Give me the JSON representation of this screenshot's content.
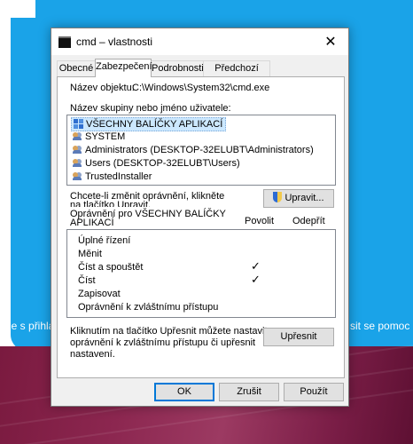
{
  "background": {
    "left_text": "ůže s přihlá",
    "right_text": "sit se pomoc"
  },
  "dialog": {
    "title": "cmd – vlastnosti",
    "close_glyph": "✕"
  },
  "tabs": [
    {
      "label": "Obecné"
    },
    {
      "label": "Zabezpečení"
    },
    {
      "label": "Podrobnosti"
    },
    {
      "label": "Předchozí verze"
    }
  ],
  "security": {
    "object_label": "Název objektu:",
    "object_value": "C:\\Windows\\System32\\cmd.exe",
    "groups_label": "Název skupiny nebo jméno uživatele:",
    "groups": [
      {
        "name": "VŠECHNY BALÍČKY APLIKACÍ",
        "icon": "app-packages-icon"
      },
      {
        "name": "SYSTEM",
        "icon": "users-icon"
      },
      {
        "name": "Administrators (DESKTOP-32ELUBT\\Administrators)",
        "icon": "users-icon"
      },
      {
        "name": "Users (DESKTOP-32ELUBT\\Users)",
        "icon": "users-icon"
      },
      {
        "name": "TrustedInstaller",
        "icon": "users-icon"
      }
    ],
    "change_hint_line1": "Chcete-li změnit oprávnění, klikněte",
    "change_hint_line2": "na tlačítko Upravit.",
    "edit_button": "Upravit...",
    "perm_header_line1": "Oprávnění pro VŠECHNY BALÍČKY",
    "perm_header_line2": "APLIKACÍ",
    "allow_header": "Povolit",
    "deny_header": "Odepřít",
    "permissions": [
      {
        "name": "Úplné řízení",
        "allow": false
      },
      {
        "name": "Měnit",
        "allow": false
      },
      {
        "name": "Číst a spouštět",
        "allow": true
      },
      {
        "name": "Číst",
        "allow": true
      },
      {
        "name": "Zapisovat",
        "allow": false
      },
      {
        "name": "Oprávnění k zvláštnímu přístupu",
        "allow": false
      }
    ],
    "check_glyph": "✓",
    "advanced_hint_line1": "Kliknutím na tlačítko Upřesnit můžete nastavit",
    "advanced_hint_line2": "oprávnění k zvláštnímu přístupu či upřesnit",
    "advanced_hint_line3": "nastavení.",
    "advanced_button": "Upřesnit"
  },
  "footer": {
    "ok": "OK",
    "cancel": "Zrušit",
    "apply": "Použít"
  }
}
